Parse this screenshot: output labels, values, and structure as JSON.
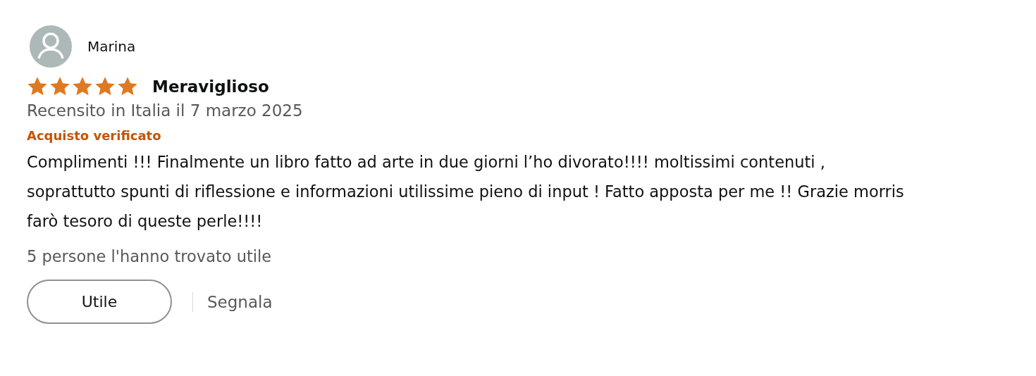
{
  "review": {
    "author": "Marina",
    "stars": 5,
    "title": "Meraviglioso",
    "date": "Recensito in Italia il 7 marzo 2025",
    "badge": "Acquisto verificato",
    "body": "Complimenti !!! Finalmente un libro fatto ad arte in due giorni l’ho divorato!!!! moltissimi contenuti , soprattutto spunti di riflessione e informazioni utilissime pieno di input ! Fatto apposta per me !! Grazie morris farò tesoro di queste perle!!!!",
    "helpful_count": "5 persone l'hanno trovato utile",
    "buttons": [
      "Utile"
    ],
    "links": [
      "Segnala"
    ]
  }
}
